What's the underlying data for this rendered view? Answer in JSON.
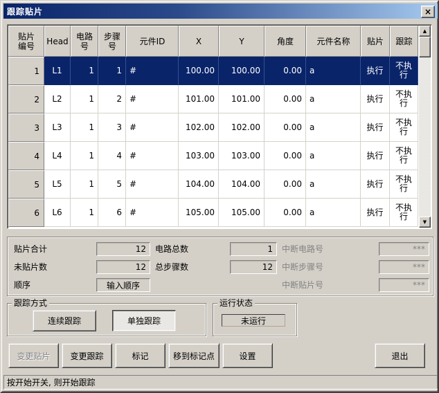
{
  "window": {
    "title": "跟踪贴片",
    "close_icon": "×"
  },
  "table": {
    "headers": [
      "贴片\n编号",
      "Head",
      "电路\n号",
      "步骤\n号",
      "元件ID",
      "X",
      "Y",
      "角度",
      "元件名称",
      "贴片",
      "跟踪"
    ],
    "rows": [
      {
        "selected": true,
        "c": [
          "1",
          "L1",
          "1",
          "1",
          "#",
          "100.00",
          "100.00",
          "0.00",
          "a",
          "执行",
          "不执行"
        ]
      },
      {
        "selected": false,
        "c": [
          "2",
          "L2",
          "1",
          "2",
          "#",
          "101.00",
          "101.00",
          "0.00",
          "a",
          "执行",
          "不执行"
        ]
      },
      {
        "selected": false,
        "c": [
          "3",
          "L3",
          "1",
          "3",
          "#",
          "102.00",
          "102.00",
          "0.00",
          "a",
          "执行",
          "不执行"
        ]
      },
      {
        "selected": false,
        "c": [
          "4",
          "L4",
          "1",
          "4",
          "#",
          "103.00",
          "103.00",
          "0.00",
          "a",
          "执行",
          "不执行"
        ]
      },
      {
        "selected": false,
        "c": [
          "5",
          "L5",
          "1",
          "5",
          "#",
          "104.00",
          "104.00",
          "0.00",
          "a",
          "执行",
          "不执行"
        ]
      },
      {
        "selected": false,
        "c": [
          "6",
          "L6",
          "1",
          "6",
          "#",
          "105.00",
          "105.00",
          "0.00",
          "a",
          "执行",
          "不执行"
        ]
      }
    ],
    "scrollbar": {
      "up_icon": "▲",
      "down_icon": "▼"
    }
  },
  "summary": {
    "total_label": "贴片合计",
    "total_value": "12",
    "remaining_label": "未贴片数",
    "remaining_value": "12",
    "order_label": "顺序",
    "order_value": "输入顺序",
    "circuits_label": "电路总数",
    "circuits_value": "1",
    "steps_label": "总步骤数",
    "steps_value": "12",
    "break_circuit_label": "中断电路号",
    "break_circuit_value": "***",
    "break_step_label": "中断步骤号",
    "break_step_value": "***",
    "break_chip_label": "中断贴片号",
    "break_chip_value": "***"
  },
  "tracking_mode": {
    "title": "跟踪方式",
    "continuous_label": "连续跟踪",
    "single_label": "单独跟踪"
  },
  "run_status": {
    "title": "运行状态",
    "value": "未运行"
  },
  "actions": {
    "change_chip": "变更贴片",
    "change_track": "变更跟踪",
    "mark": "标记",
    "move_to_mark": "移到标记点",
    "settings": "设置",
    "exit": "退出"
  },
  "status_bar": {
    "text": "按开始开关, 则开始跟踪"
  },
  "colors": {
    "titlebar_start": "#0a246a",
    "titlebar_end": "#a6caf0",
    "selection": "#0a246a",
    "dialog_bg": "#d4d0c8",
    "grid_bg": "#ffffff",
    "disabled_text": "#838383"
  }
}
